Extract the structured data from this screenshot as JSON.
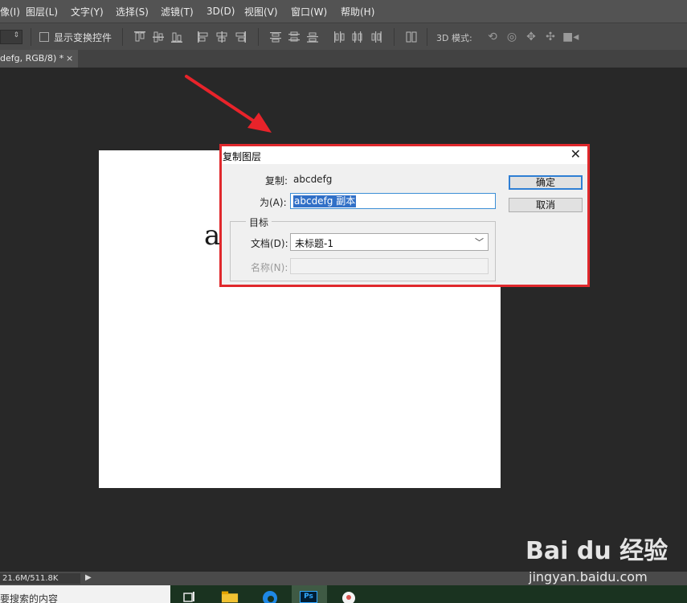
{
  "menubar": {
    "items": [
      "像(I)",
      "图层(L)",
      "文字(Y)",
      "选择(S)",
      "滤镜(T)",
      "3D(D)",
      "视图(V)",
      "窗口(W)",
      "帮助(H)"
    ]
  },
  "options_bar": {
    "show_transform_label": "显示变换控件",
    "show_transform_checked": false,
    "mode_3d_label": "3D 模式:"
  },
  "document_tab": {
    "title": "defg, RGB/8) *",
    "close": "×"
  },
  "canvas": {
    "visible_text": "a"
  },
  "dialog": {
    "title": "复制图层",
    "close": "✕",
    "copy_label": "复制:",
    "copy_value": "abcdefg",
    "as_label": "为(A):",
    "as_value": "abcdefg 副本",
    "group_label": "目标",
    "document_label": "文档(D):",
    "document_value": "未标题-1",
    "name_label": "名称(N):",
    "ok_button": "确定",
    "cancel_button": "取消"
  },
  "statusbar": {
    "doc_size": "21.6M/511.8K",
    "arrow": "▶"
  },
  "taskbar": {
    "search_text": "要搜索的内容"
  },
  "watermark": {
    "brand": "Bai du 经验",
    "url": "jingyan.baidu.com"
  },
  "colors": {
    "highlight_border": "#e0282c",
    "arrow": "#e8232a",
    "selection": "#3170c7"
  }
}
